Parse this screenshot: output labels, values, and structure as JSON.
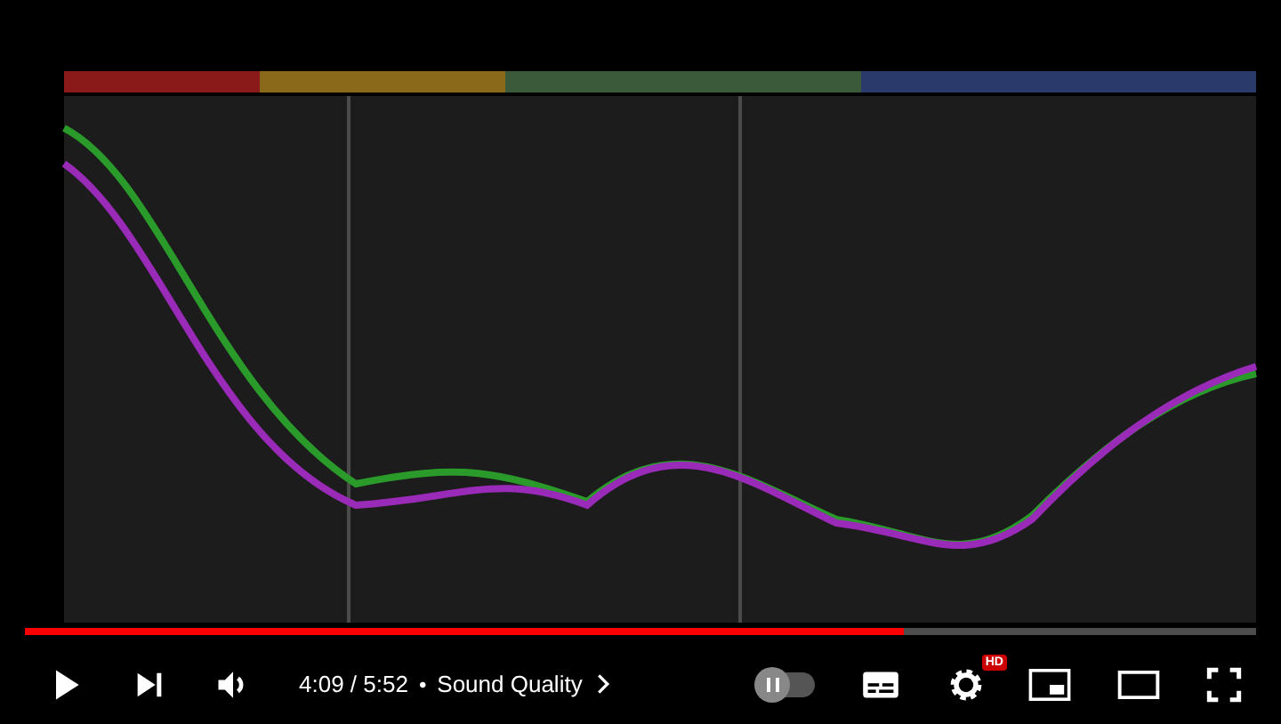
{
  "progress": {
    "level": 0.714
  },
  "controls": {
    "time": "4:09 / 5:52",
    "separator": "•",
    "chapter": "Sound Quality",
    "autoplay": {
      "on": false
    },
    "quality_badge": "HD"
  }
}
